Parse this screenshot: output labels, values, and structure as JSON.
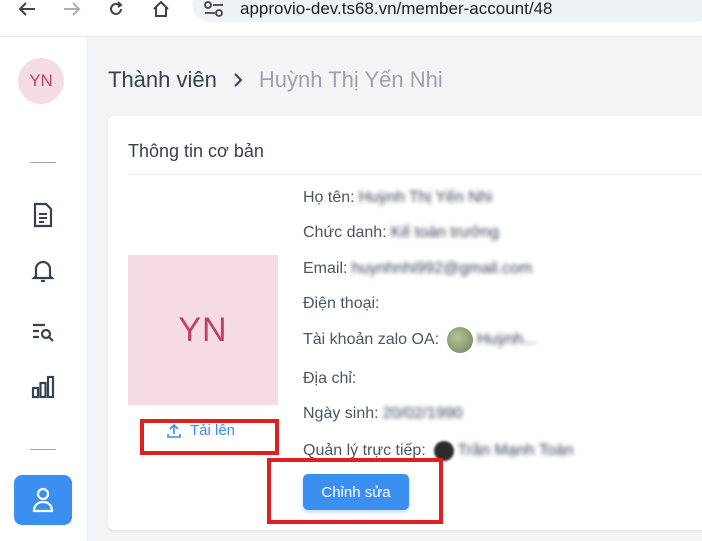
{
  "browser": {
    "url": "approvio-dev.ts68.vn/member-account/48"
  },
  "sidebar": {
    "avatar_initials": "YN"
  },
  "breadcrumb": {
    "root": "Thành viên",
    "current": "Huỳnh Thị Yến Nhi"
  },
  "card": {
    "title": "Thông tin cơ bản",
    "avatar_initials": "YN",
    "upload_label": "Tải lên",
    "edit_label": "Chỉnh sửa",
    "fields": {
      "name_label": "Họ tên:",
      "name_value": "Huỳnh Thị Yến Nhi",
      "title_label": "Chức danh:",
      "title_value": "Kế toán trưởng",
      "email_label": "Email:",
      "email_value": "huynhnhi992@gmail.com",
      "phone_label": "Điện thoại:",
      "zalo_label": "Tài khoản zalo OA:",
      "zalo_value": "Huỳnh...",
      "address_label": "Địa chỉ:",
      "birth_label": "Ngày sinh:",
      "birth_value": "20/02/1990",
      "manager_label": "Quản lý trực tiếp:",
      "manager_value": "Trần Mạnh Toàn"
    }
  },
  "colors": {
    "accent": "#3b8ff0",
    "avatar_bg": "#f5dbe3",
    "avatar_text": "#c2405f",
    "highlight": "#e02020"
  }
}
